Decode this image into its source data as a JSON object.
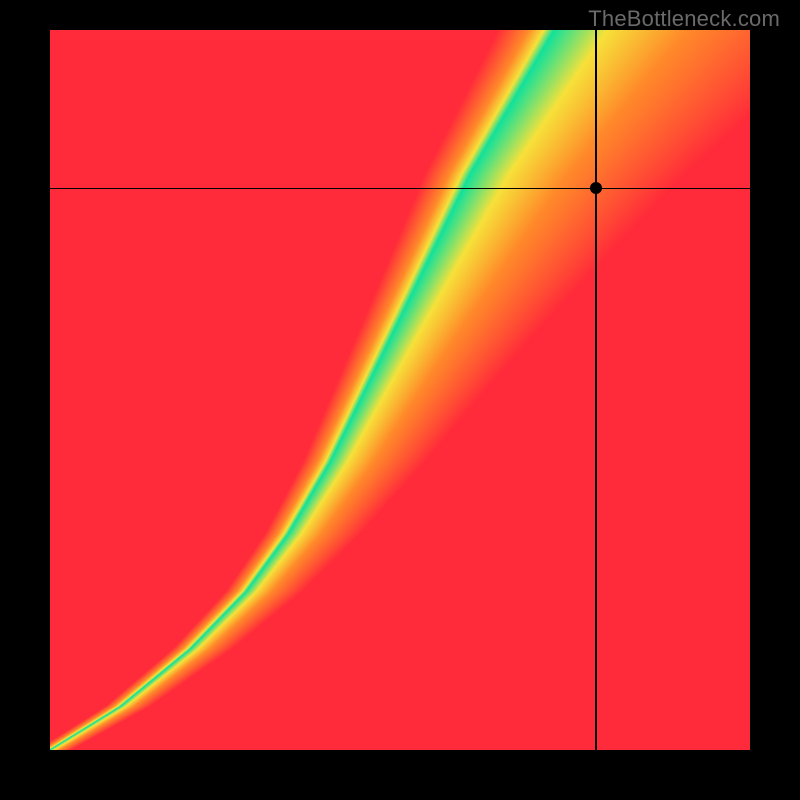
{
  "watermark": "TheBottleneck.com",
  "chart_data": {
    "type": "heatmap",
    "title": "",
    "xlabel": "",
    "ylabel": "",
    "xlim": [
      0,
      1
    ],
    "ylim": [
      0,
      1
    ],
    "crosshair": {
      "x": 0.78,
      "y": 0.78
    },
    "marker": {
      "x": 0.78,
      "y": 0.78
    },
    "ridge_points": [
      [
        0.0,
        0.0
      ],
      [
        0.1,
        0.06
      ],
      [
        0.2,
        0.14
      ],
      [
        0.28,
        0.22
      ],
      [
        0.34,
        0.3
      ],
      [
        0.4,
        0.4
      ],
      [
        0.45,
        0.5
      ],
      [
        0.5,
        0.6
      ],
      [
        0.55,
        0.7
      ],
      [
        0.6,
        0.8
      ],
      [
        0.66,
        0.9
      ],
      [
        0.72,
        1.0
      ]
    ],
    "ridge_width_base": 0.035,
    "ridge_width_top": 0.09,
    "colors": {
      "green": "#12e29b",
      "yellow": "#f7e13a",
      "orange": "#ff8a2a",
      "red": "#ff2a3a"
    },
    "grid": false,
    "legend": false
  }
}
